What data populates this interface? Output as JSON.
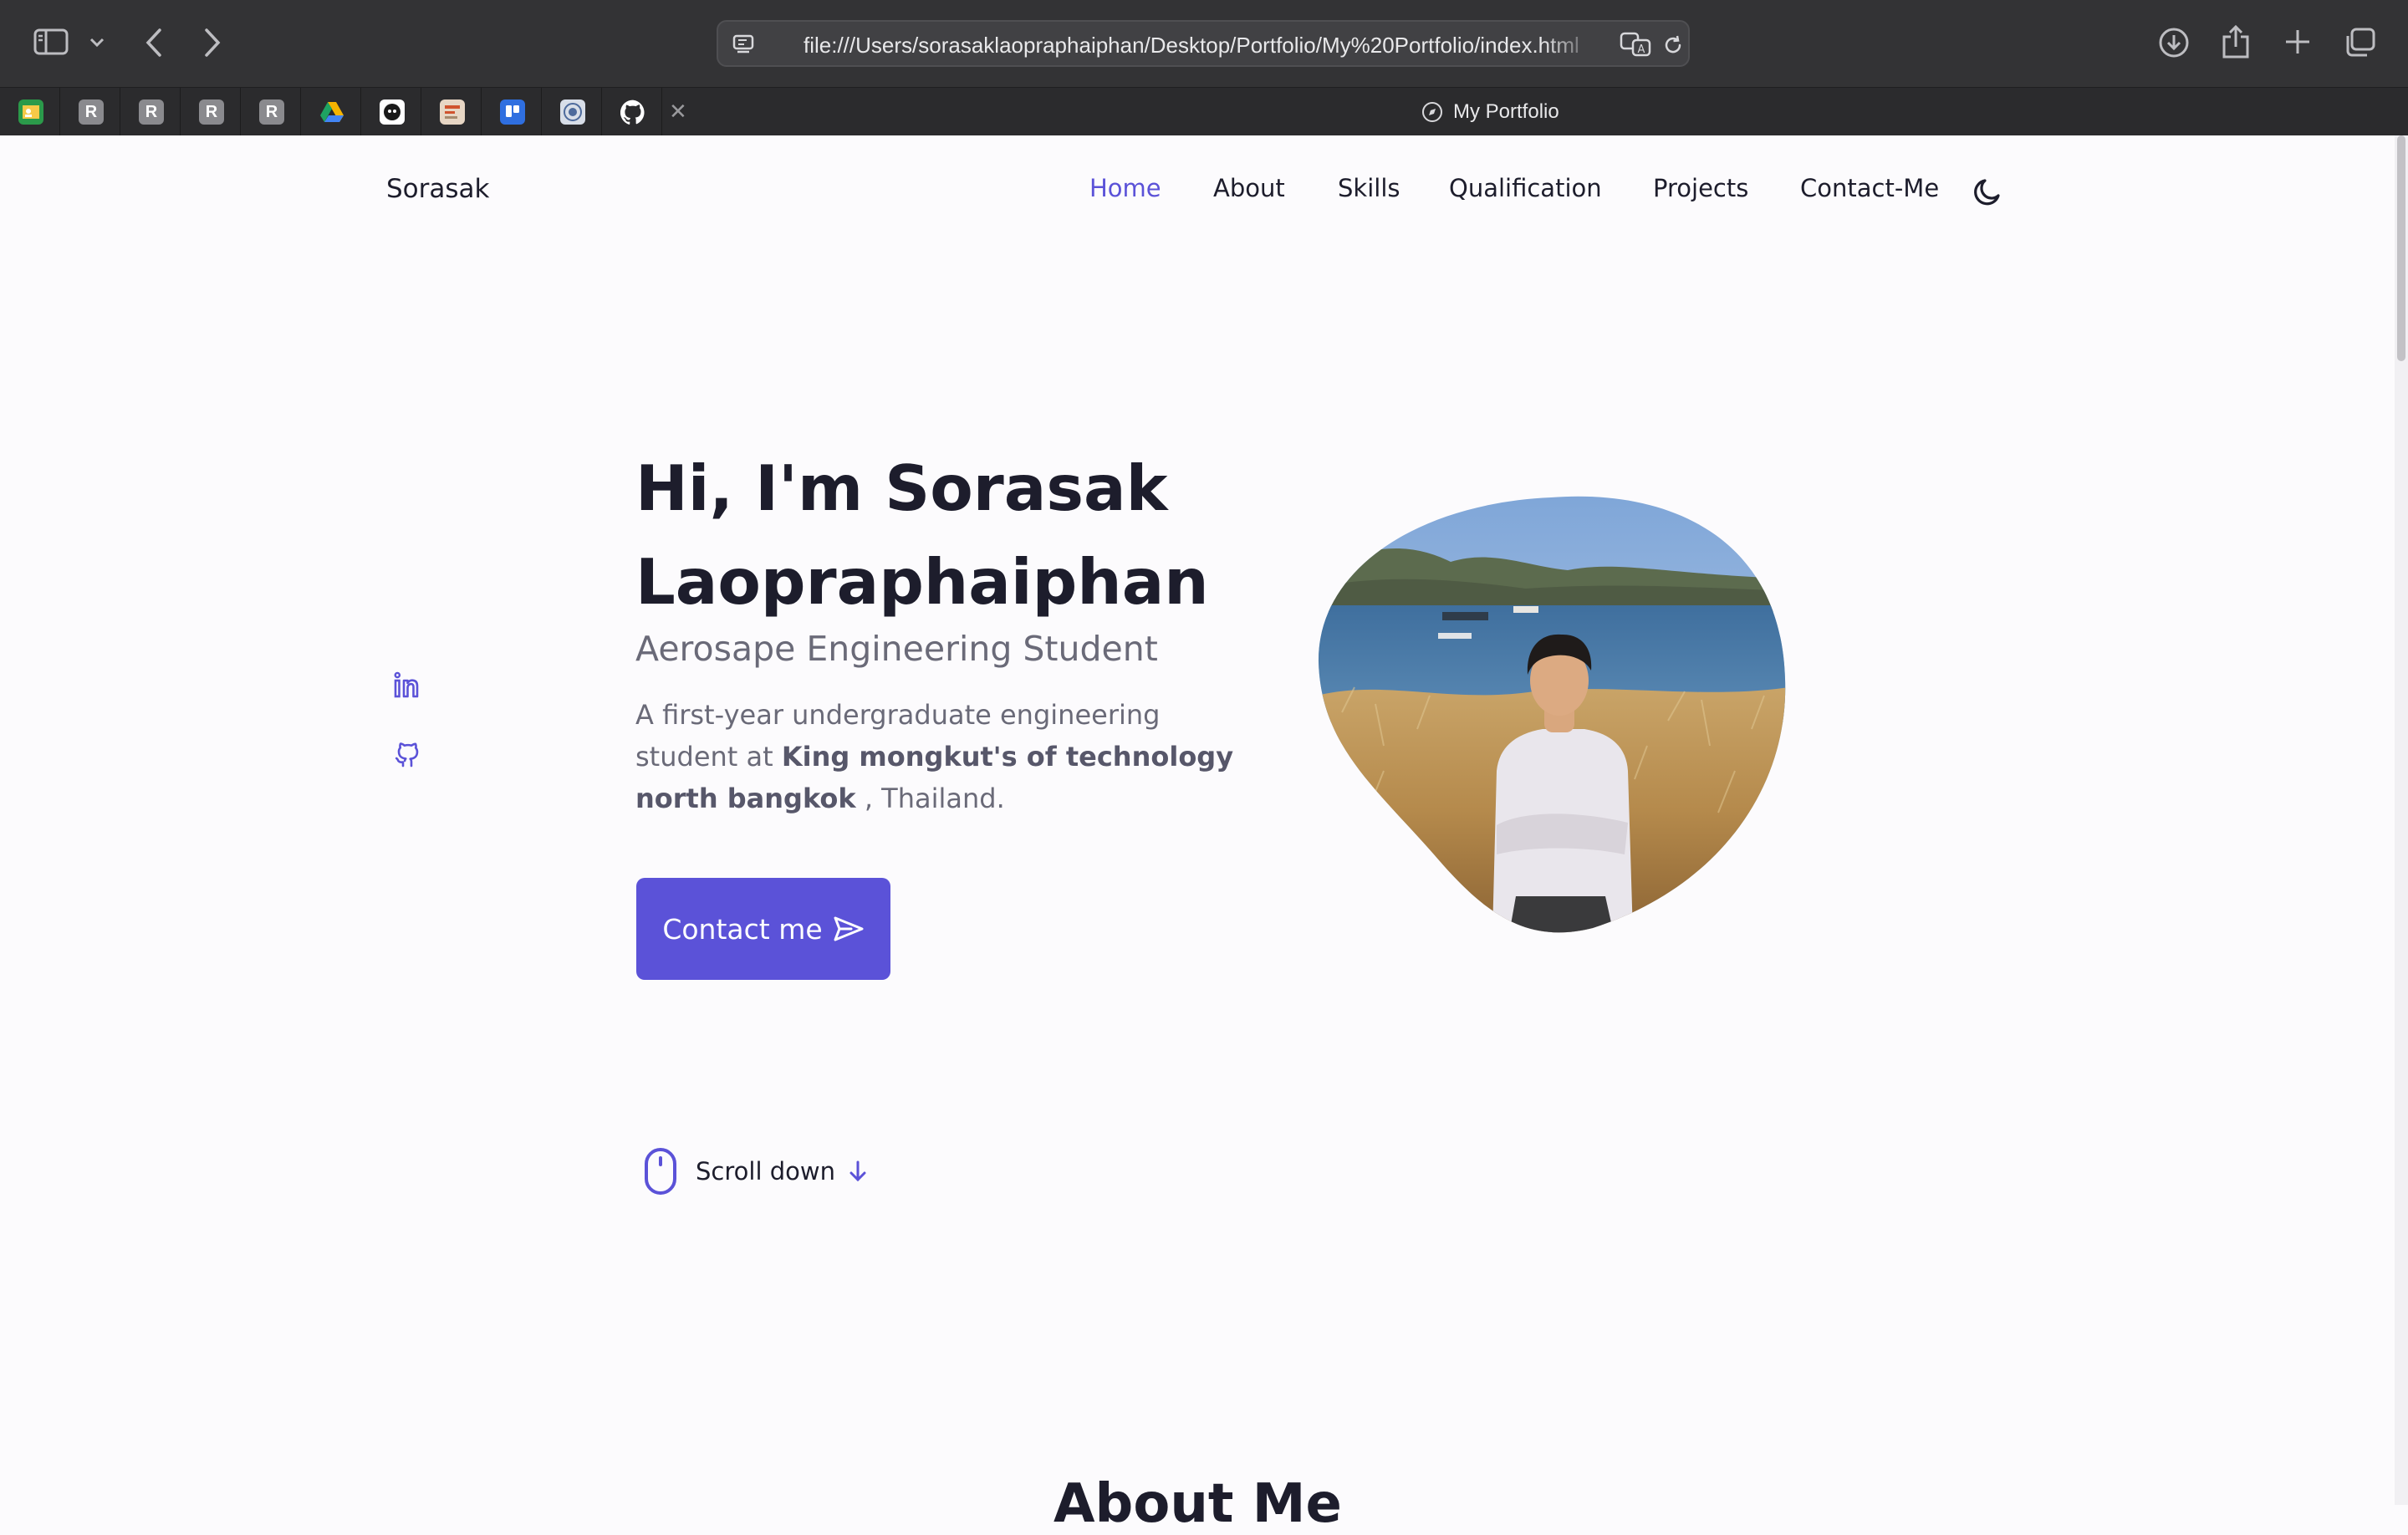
{
  "browser": {
    "url": "file:///Users/sorasaklaopraphaiphan/Desktop/Portfolio/My%20Portfolio/index.html",
    "active_tab_title": "My Portfolio",
    "pinned_tabs": [
      {
        "icon": "classroom-icon",
        "label": "",
        "color": "#2b9a4a"
      },
      {
        "icon": "r-letter-icon",
        "label": "R",
        "color": "#8a8a8e"
      },
      {
        "icon": "r-letter-icon",
        "label": "R",
        "color": "#8a8a8e"
      },
      {
        "icon": "r-letter-icon",
        "label": "R",
        "color": "#8a8a8e"
      },
      {
        "icon": "r-letter-icon",
        "label": "R",
        "color": "#8a8a8e"
      },
      {
        "icon": "google-drive-icon",
        "label": "",
        "color": "#2b2b2d"
      },
      {
        "icon": "chatbot-icon",
        "label": "",
        "color": "#ffffff"
      },
      {
        "icon": "site-thumbnail-icon",
        "label": "",
        "color": "#e7d6c4"
      },
      {
        "icon": "trello-icon",
        "label": "",
        "color": "#2f6fe0"
      },
      {
        "icon": "university-seal-icon",
        "label": "",
        "color": "#d8dee8"
      },
      {
        "icon": "github-icon",
        "label": "",
        "color": "#2b2b2d"
      }
    ]
  },
  "site": {
    "logo": "Sorasak",
    "nav": [
      {
        "label": "Home",
        "active": true
      },
      {
        "label": "About",
        "active": false
      },
      {
        "label": "Skills",
        "active": false
      },
      {
        "label": "Qualification",
        "active": false
      },
      {
        "label": "Projects",
        "active": false
      },
      {
        "label": "Contact-Me",
        "active": false
      }
    ],
    "theme_toggle_icon": "moon-icon",
    "accent_color": "#5b52d8"
  },
  "hero": {
    "title": "Hi, I'm Sorasak Laopraphaiphan",
    "subtitle": "Aerosape Engineering Student",
    "desc_pre": "A first-year undergraduate engineering student at ",
    "desc_bold": "King mongkut's of technology north bangkok",
    "desc_post": " , Thailand.",
    "button_label": "Contact me",
    "button_icon": "send-icon",
    "social": [
      "linkedin-icon",
      "github-icon"
    ],
    "scroll_label": "Scroll down",
    "scroll_icons": [
      "mouse-icon",
      "arrow-down-icon"
    ],
    "photo_icon": "profile-photo"
  },
  "next_section": {
    "title": "About Me"
  }
}
